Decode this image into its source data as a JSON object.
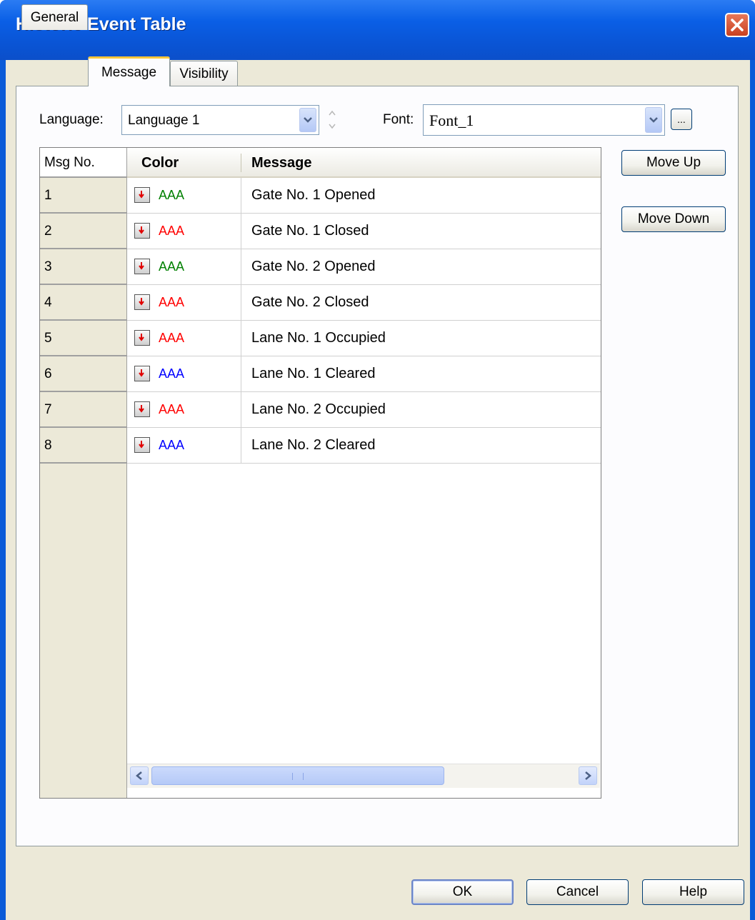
{
  "window": {
    "title": "Historic Event Table"
  },
  "tabs": [
    {
      "label": "General",
      "active": false
    },
    {
      "label": "Message",
      "active": true
    },
    {
      "label": "Visibility",
      "active": false
    }
  ],
  "language": {
    "label": "Language:",
    "value": "Language 1"
  },
  "font": {
    "label": "Font:",
    "value": "Font_1",
    "browse_label": "..."
  },
  "table": {
    "headers": {
      "no": "Msg No.",
      "color": "Color",
      "message": "Message"
    },
    "rows": [
      {
        "no": "1",
        "sample": "AAA",
        "color": "#008000",
        "message": "Gate No. 1 Opened"
      },
      {
        "no": "2",
        "sample": "AAA",
        "color": "#ff0000",
        "message": "Gate No. 1 Closed"
      },
      {
        "no": "3",
        "sample": "AAA",
        "color": "#008000",
        "message": "Gate No. 2 Opened"
      },
      {
        "no": "4",
        "sample": "AAA",
        "color": "#ff0000",
        "message": "Gate No. 2 Closed"
      },
      {
        "no": "5",
        "sample": "AAA",
        "color": "#ff0000",
        "message": "Lane No. 1 Occupied"
      },
      {
        "no": "6",
        "sample": "AAA",
        "color": "#0000ff",
        "message": "Lane No. 1 Cleared"
      },
      {
        "no": "7",
        "sample": "AAA",
        "color": "#ff0000",
        "message": "Lane No. 2 Occupied"
      },
      {
        "no": "8",
        "sample": "AAA",
        "color": "#0000ff",
        "message": "Lane No. 2 Cleared"
      }
    ]
  },
  "side_buttons": {
    "move_up": "Move Up",
    "move_down": "Move Down"
  },
  "footer": {
    "ok": "OK",
    "cancel": "Cancel",
    "help": "Help"
  },
  "icons": {
    "close": "close-icon",
    "dropdown": "chevron-down-icon",
    "color_picker": "color-picker-icon"
  }
}
